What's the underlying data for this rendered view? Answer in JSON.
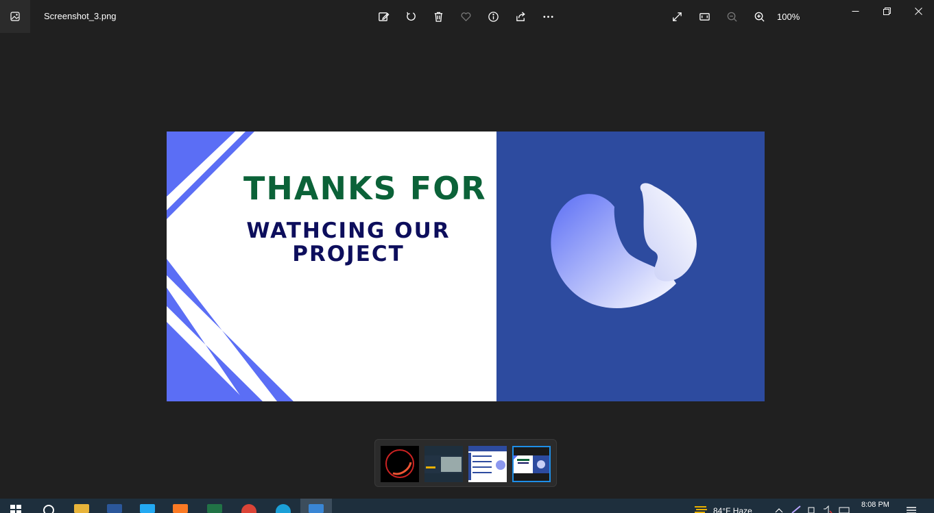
{
  "titlebar": {
    "file_name": "Screenshot_3.png",
    "zoom": "100%",
    "toolbar_icons": [
      "edit-icon",
      "rotate-icon",
      "delete-icon",
      "favorite-icon",
      "info-icon",
      "share-icon",
      "more-icon"
    ],
    "right_icons": [
      "fullscreen-icon",
      "fit-icon",
      "zoom-out-icon",
      "zoom-in-icon"
    ],
    "window_controls": [
      "minimize-icon",
      "restore-icon",
      "close-icon"
    ]
  },
  "slide": {
    "heading": "THANKS FOR",
    "subheading": "WATHCING OUR PROJECT",
    "colors": {
      "left_bg": "#ffffff",
      "right_bg": "#2d4b9f",
      "stripe": "#5b6ef5",
      "heading": "#0b6238",
      "subheading": "#0d0e5c"
    }
  },
  "filmstrip": {
    "thumbnails": [
      {
        "name": "thumb-1",
        "selected": false
      },
      {
        "name": "thumb-2",
        "selected": false
      },
      {
        "name": "thumb-3",
        "selected": false
      },
      {
        "name": "thumb-4",
        "selected": true
      }
    ]
  },
  "taskbar": {
    "weather": "84°F  Haze",
    "time": "8:08 PM",
    "apps": [
      "start-icon",
      "search-icon",
      "file-explorer-icon",
      "word-icon",
      "vscode-icon",
      "xampp-icon",
      "excel-icon",
      "chrome-icon",
      "edge-icon",
      "photos-icon"
    ]
  }
}
